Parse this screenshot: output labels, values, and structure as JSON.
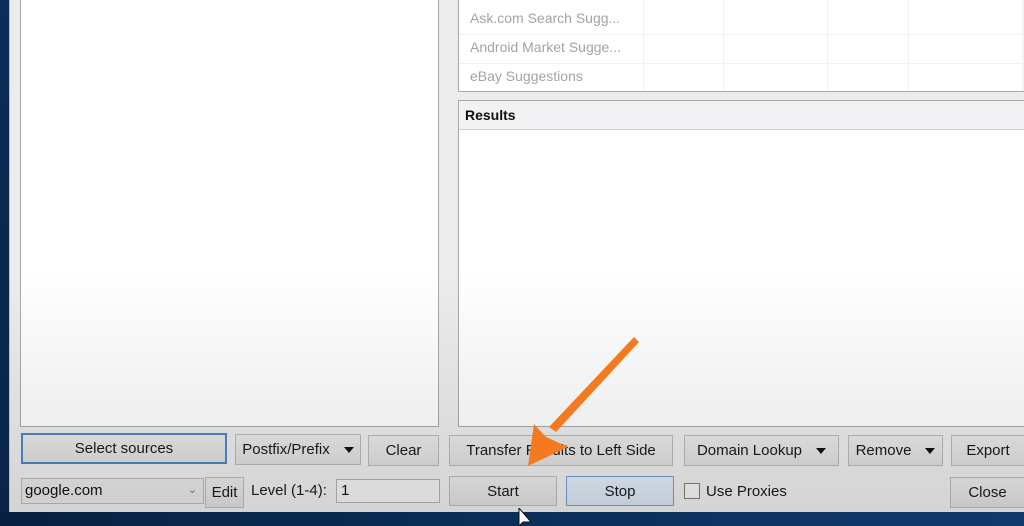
{
  "colors": {
    "desktop": "#0a2a52",
    "window_bg": "#ececec",
    "focus_border": "#4d86c4",
    "annotation_arrow": "#f47a1f"
  },
  "sources_grid": {
    "rows": [
      {
        "name": "Ask.com Search Sugg..."
      },
      {
        "name": "Android Market Sugge..."
      },
      {
        "name": "eBay Suggestions"
      }
    ]
  },
  "results": {
    "header": "Results"
  },
  "left_controls": {
    "select_sources": "Select sources",
    "postfix_prefix": "Postfix/Prefix",
    "clear": "Clear",
    "engine_value": "google.com",
    "edit": "Edit",
    "level_label": "Level (1-4):",
    "level_value": "1"
  },
  "right_controls": {
    "transfer": "Transfer Results to Left Side",
    "domain_lookup": "Domain Lookup",
    "remove": "Remove",
    "export": "Export",
    "start": "Start",
    "stop": "Stop",
    "use_proxies": "Use Proxies",
    "use_proxies_checked": false,
    "close": "Close"
  },
  "icons": {
    "dropdown_caret": "▼",
    "combo_chevron": "⌄"
  }
}
